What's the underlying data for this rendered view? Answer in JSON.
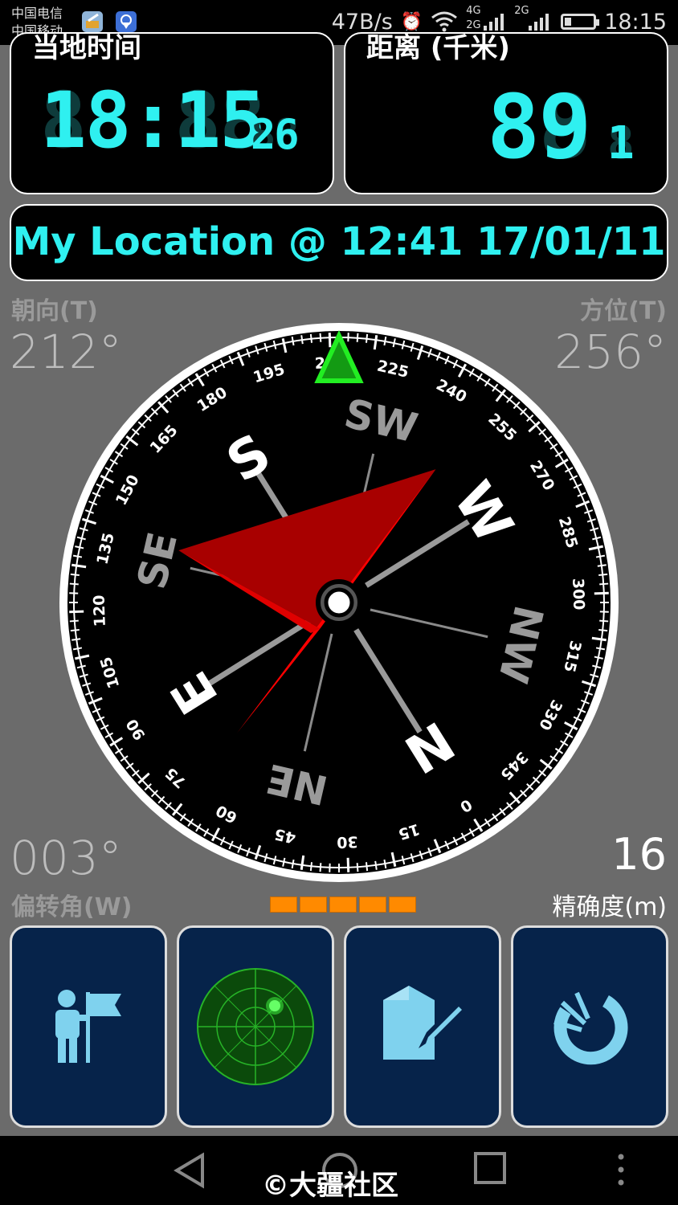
{
  "status_bar": {
    "carrier_1": "中国电信",
    "carrier_2": "中国移动",
    "net_speed": "47B/s",
    "network_1": "4G",
    "network_1b": "2G",
    "network_2": "2G",
    "time": "18:15",
    "icons": [
      "cleaner-app-icon",
      "location-app-icon",
      "alarm-icon",
      "wifi-icon",
      "signal-icon",
      "battery-icon"
    ]
  },
  "time_panel": {
    "label": "当地时间",
    "hours_minutes": "18:15",
    "seconds": "26"
  },
  "distance_panel": {
    "label": "距离 (千米)",
    "value": "89",
    "unit_digit": "1"
  },
  "location_banner": {
    "text": "My Location @ 12:41 17/01/11"
  },
  "heading": {
    "label": "朝向(T)",
    "value": "212°"
  },
  "bearing": {
    "label": "方位(T)",
    "value": "256°"
  },
  "declination": {
    "label": "偏转角(W)",
    "value": "003°"
  },
  "accuracy": {
    "label": "精确度(m)",
    "value": "16",
    "bars": 5
  },
  "compass": {
    "rotation_deg": 148,
    "needle_heading_deg": 212,
    "target_bearing_deg": 256,
    "cardinals": [
      {
        "text": "N",
        "deg": 0,
        "major": true
      },
      {
        "text": "NE",
        "deg": 45,
        "major": false
      },
      {
        "text": "E",
        "deg": 90,
        "major": true
      },
      {
        "text": "SE",
        "deg": 135,
        "major": false
      },
      {
        "text": "S",
        "deg": 180,
        "major": true
      },
      {
        "text": "SW",
        "deg": 225,
        "major": false
      },
      {
        "text": "W",
        "deg": 270,
        "major": true
      },
      {
        "text": "NW",
        "deg": 315,
        "major": false
      }
    ],
    "degree_labels": [
      "0",
      "15",
      "30",
      "45",
      "60",
      "75",
      "90",
      "105",
      "120",
      "135",
      "150",
      "165",
      "180",
      "195",
      "210",
      "225",
      "240",
      "255",
      "270",
      "285",
      "300",
      "315",
      "330",
      "345"
    ],
    "colors": {
      "needle": "#ff0000",
      "needle_dark": "#a80000",
      "marker": "#22dd22"
    }
  },
  "tiles": [
    {
      "name": "person-flag-icon"
    },
    {
      "name": "radar-icon"
    },
    {
      "name": "edit-note-icon"
    },
    {
      "name": "refresh-icon"
    }
  ],
  "nav": {
    "back": "back-icon",
    "home": "home-icon",
    "recent": "recent-apps-icon",
    "menu": "menu-icon"
  },
  "watermark": "©大疆社区",
  "accent_color": "#2ff0f0"
}
